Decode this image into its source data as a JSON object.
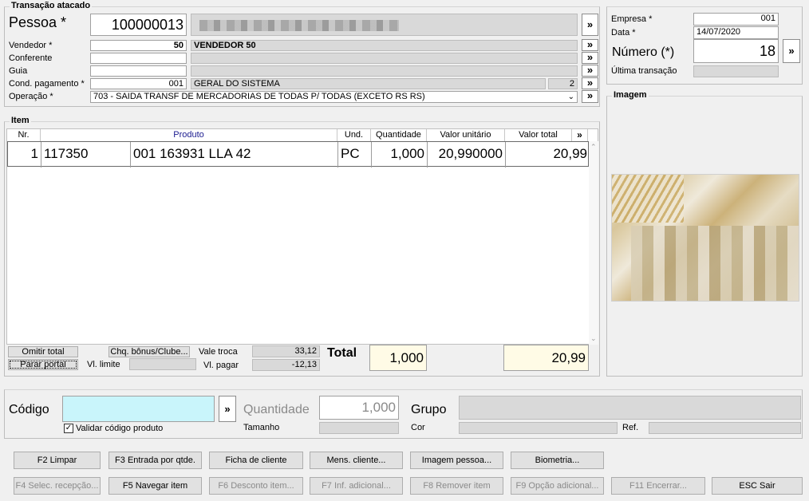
{
  "transacao": {
    "title": "Transação atacado",
    "pessoa_label": "Pessoa *",
    "pessoa_code": "100000013",
    "vendedor_label": "Vendedor *",
    "vendedor_code": "50",
    "vendedor_name": "VENDEDOR 50",
    "conferente_label": "Conferente",
    "guia_label": "Guia",
    "cond_label": "Cond. pagamento *",
    "cond_code": "001",
    "cond_name": "GERAL DO SISTEMA",
    "cond_num": "2",
    "operacao_label": "Operação *",
    "operacao_value": "703 - SAIDA TRANSF DE MERCADORIAS DE TODAS P/ TODAS (EXCETO RS RS)",
    "more_label": "»"
  },
  "empresa": {
    "empresa_label": "Empresa *",
    "empresa_value": "001",
    "data_label": "Data *",
    "data_value": "14/07/2020",
    "numero_label": "Número (*)",
    "numero_value": "18",
    "ultima_label": "Última transação"
  },
  "imagem": {
    "title": "Imagem"
  },
  "item": {
    "title": "Item",
    "headers": [
      "Nr.",
      "Produto",
      "Und.",
      "Quantidade",
      "Valor unitário",
      "Valor total",
      "»"
    ],
    "rows": [
      {
        "nr": "1",
        "codigo": "117350",
        "descricao": "001 163931 LLA 42",
        "und": "PC",
        "quantidade": "1,000",
        "valor_unitario": "20,990000",
        "valor_total": "20,99"
      }
    ],
    "omitir_total": "Omitir total",
    "parar_portal": "Parar portal",
    "chq_bonus": "Chq. bônus/Clube...",
    "vl_limite_label": "Vl. limite",
    "vale_troca_label": "Vale troca",
    "vale_troca_value": "33,12",
    "vl_pagar_label": "Vl. pagar",
    "vl_pagar_value": "-12,13",
    "total_label": "Total",
    "total_qtd": "1,000",
    "total_valor": "20,99"
  },
  "codigo_panel": {
    "codigo_label": "Código",
    "validar_label": "Validar código produto",
    "quantidade_label": "Quantidade",
    "quantidade_value": "1,000",
    "tamanho_label": "Tamanho",
    "grupo_label": "Grupo",
    "cor_label": "Cor",
    "ref_label": "Ref."
  },
  "buttons": {
    "f2": "F2 Limpar",
    "f3": "F3 Entrada por qtde.",
    "ficha": "Ficha de cliente",
    "mens": "Mens. cliente...",
    "imagem": "Imagem pessoa...",
    "biometria": "Biometria...",
    "f4": "F4 Selec. recepção...",
    "f5": "F5 Navegar item",
    "f6": "F6 Desconto item...",
    "f7": "F7 Inf. adicional...",
    "f8": "F8 Remover item",
    "f9": "F9 Opção adicional...",
    "f11": "F11 Encerrar...",
    "esc": "ESC Sair"
  },
  "colors": {
    "codigo_bg": "#c9f5fb",
    "total_bg": "#fffbe6",
    "header_text": "#1b1b8f"
  }
}
